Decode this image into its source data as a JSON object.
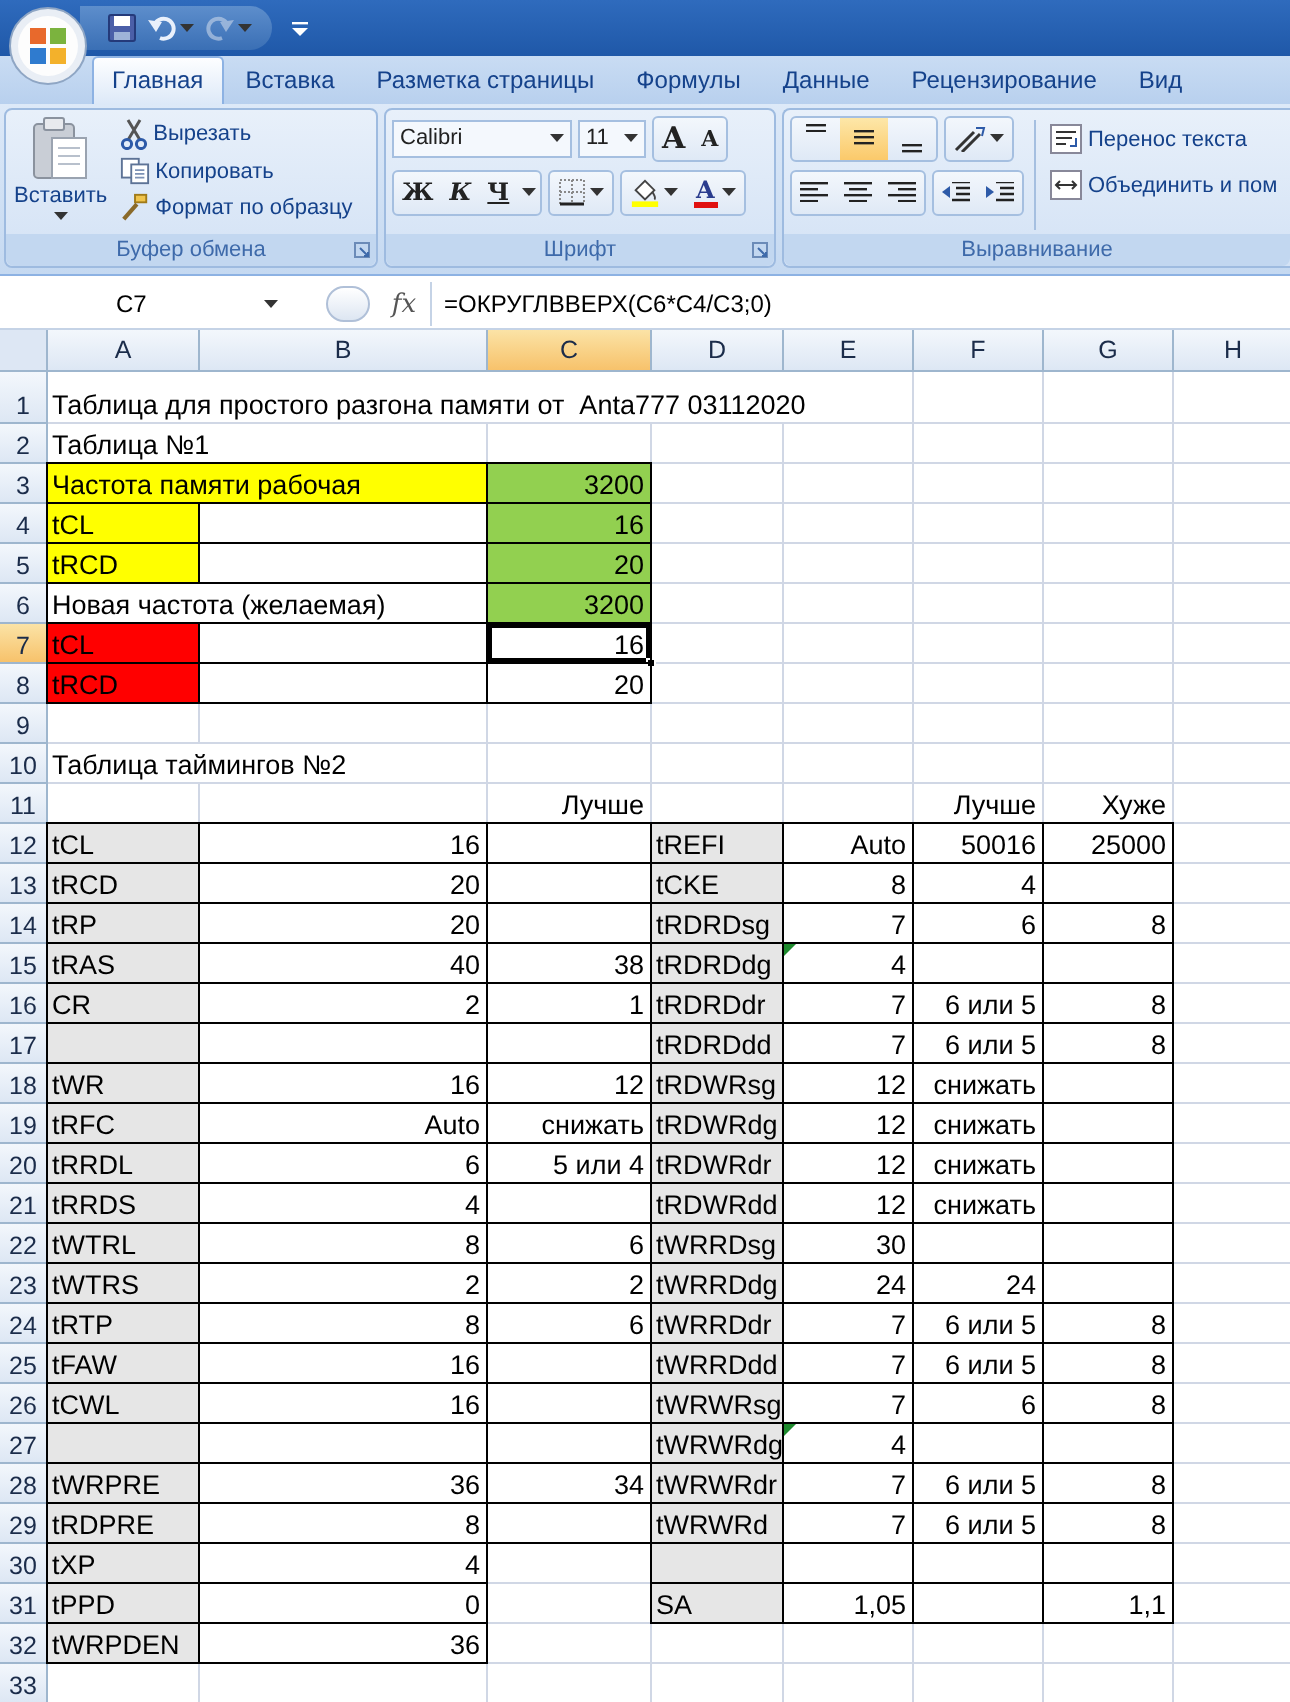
{
  "tabs": [
    {
      "label": "Главная",
      "selected": true
    },
    {
      "label": "Вставка",
      "selected": false
    },
    {
      "label": "Разметка страницы",
      "selected": false
    },
    {
      "label": "Формулы",
      "selected": false
    },
    {
      "label": "Данные",
      "selected": false
    },
    {
      "label": "Рецензирование",
      "selected": false
    },
    {
      "label": "Вид",
      "selected": false
    }
  ],
  "clipboard": {
    "title": "Буфер обмена",
    "paste": "Вставить",
    "cut": "Вырезать",
    "copy": "Копировать",
    "format_painter": "Формат по образцу"
  },
  "font": {
    "title": "Шрифт",
    "family": "Calibri",
    "size": "11",
    "grow": "A",
    "shrink": "A",
    "bold": "Ж",
    "italic": "К",
    "underline": "Ч",
    "font_color": "A"
  },
  "alignment": {
    "title": "Выравнивание",
    "vertical": [
      {
        "kind": "top",
        "selected": false
      },
      {
        "kind": "middle",
        "selected": true
      },
      {
        "kind": "bottom",
        "selected": false
      }
    ],
    "wrap": "Перенос текста",
    "merge": "Объединить и пом"
  },
  "formula_bar": {
    "name_box": "C7",
    "fx": "fx",
    "formula": "=ОКРУГЛВВЕРХ(C6*C4/C3;0)"
  },
  "sheet": {
    "columns": [
      {
        "label": "A",
        "selected": false
      },
      {
        "label": "B",
        "selected": false
      },
      {
        "label": "C",
        "selected": true
      },
      {
        "label": "D",
        "selected": false
      },
      {
        "label": "E",
        "selected": false
      },
      {
        "label": "F",
        "selected": false
      },
      {
        "label": "G",
        "selected": false
      },
      {
        "label": "H",
        "selected": false
      }
    ],
    "rows": [
      {
        "label": "1",
        "selected": false,
        "cells": [
          {
            "kind": "plain",
            "text": "Таблица для простого разгона памяти от  Anta777 03112020"
          },
          {
            "kind": "covered"
          },
          {
            "kind": "covered"
          },
          {
            "kind": "covered"
          },
          {
            "kind": "covered"
          }
        ]
      },
      {
        "label": "2",
        "selected": false,
        "cells": [
          {
            "kind": "plain",
            "text": "Таблица №1"
          },
          {
            "kind": "covered"
          }
        ]
      },
      {
        "label": "3",
        "selected": false,
        "cells": [
          {
            "kind": "boxed",
            "text": "Частота памяти рабочая",
            "color": "#ffff00"
          },
          {
            "kind": "covered"
          },
          {
            "kind": "boxed",
            "text": "3200",
            "color": "#92d050"
          }
        ]
      },
      {
        "label": "4",
        "selected": false,
        "cells": [
          {
            "kind": "boxed",
            "text": "tCL",
            "color": "#ffff00"
          },
          {
            "kind": "boxed"
          },
          {
            "kind": "boxed",
            "text": "16",
            "color": "#92d050"
          }
        ]
      },
      {
        "label": "5",
        "selected": false,
        "cells": [
          {
            "kind": "boxed",
            "text": "tRCD",
            "color": "#ffff00"
          },
          {
            "kind": "boxed"
          },
          {
            "kind": "boxed",
            "text": "20",
            "color": "#92d050"
          }
        ]
      },
      {
        "label": "6",
        "selected": false,
        "cells": [
          {
            "kind": "boxed",
            "text": "Новая частота (желаемая)"
          },
          {
            "kind": "covered"
          },
          {
            "kind": "boxed",
            "text": "3200",
            "color": "#92d050"
          }
        ]
      },
      {
        "label": "7",
        "selected": true,
        "cells": [
          {
            "kind": "boxed",
            "text": "tCL",
            "color": "#ff0000"
          },
          {
            "kind": "boxed"
          },
          {
            "kind": "boxed",
            "text": "16",
            "selected": true
          }
        ]
      },
      {
        "label": "8",
        "selected": false,
        "cells": [
          {
            "kind": "boxed",
            "text": "tRCD",
            "color": "#ff0000"
          },
          {
            "kind": "boxed"
          },
          {
            "kind": "boxed",
            "text": "20"
          }
        ]
      },
      {
        "label": "9",
        "selected": false,
        "cells": []
      },
      {
        "label": "10",
        "selected": false,
        "cells": [
          {
            "kind": "plain",
            "text": "Таблица таймингов №2"
          },
          {
            "kind": "covered"
          }
        ]
      },
      {
        "label": "11",
        "selected": false,
        "cells": [
          {
            "kind": "plain"
          },
          {
            "kind": "plain"
          },
          {
            "kind": "plain",
            "text": "Лучше"
          },
          {
            "kind": "plain"
          },
          {
            "kind": "plain"
          },
          {
            "kind": "plain",
            "text": "Лучше"
          },
          {
            "kind": "plain",
            "text": "Хуже"
          }
        ]
      },
      {
        "label": "12",
        "selected": false,
        "cells": [
          {
            "kind": "boxed",
            "text": "tCL",
            "color": "#e6e6e6"
          },
          {
            "kind": "boxed",
            "text": "16"
          },
          {
            "kind": "boxed"
          },
          {
            "kind": "boxed",
            "text": "tREFI",
            "color": "#e6e6e6"
          },
          {
            "kind": "boxed",
            "text": "Auto"
          },
          {
            "kind": "boxed",
            "text": "50016"
          },
          {
            "kind": "boxed",
            "text": "25000"
          }
        ]
      },
      {
        "label": "13",
        "selected": false,
        "cells": [
          {
            "kind": "boxed",
            "text": "tRCD",
            "color": "#e6e6e6"
          },
          {
            "kind": "boxed",
            "text": "20"
          },
          {
            "kind": "boxed"
          },
          {
            "kind": "boxed",
            "text": "tCKE",
            "color": "#e6e6e6"
          },
          {
            "kind": "boxed",
            "text": "8"
          },
          {
            "kind": "boxed",
            "text": "4"
          },
          {
            "kind": "boxed"
          }
        ]
      },
      {
        "label": "14",
        "selected": false,
        "cells": [
          {
            "kind": "boxed",
            "text": "tRP",
            "color": "#e6e6e6"
          },
          {
            "kind": "boxed",
            "text": "20"
          },
          {
            "kind": "boxed"
          },
          {
            "kind": "boxed",
            "text": "tRDRDsg",
            "color": "#e6e6e6"
          },
          {
            "kind": "boxed",
            "text": "7"
          },
          {
            "kind": "boxed",
            "text": "6"
          },
          {
            "kind": "boxed",
            "text": "8"
          }
        ]
      },
      {
        "label": "15",
        "selected": false,
        "cells": [
          {
            "kind": "boxed",
            "text": "tRAS",
            "color": "#e6e6e6"
          },
          {
            "kind": "boxed",
            "text": "40"
          },
          {
            "kind": "boxed",
            "text": "38"
          },
          {
            "kind": "boxed",
            "text": "tRDRDdg",
            "color": "#e6e6e6"
          },
          {
            "kind": "boxed",
            "text": "4",
            "error_mark": true
          },
          {
            "kind": "boxed"
          },
          {
            "kind": "boxed"
          }
        ]
      },
      {
        "label": "16",
        "selected": false,
        "cells": [
          {
            "kind": "boxed",
            "text": "CR",
            "color": "#e6e6e6"
          },
          {
            "kind": "boxed",
            "text": "2"
          },
          {
            "kind": "boxed",
            "text": "1"
          },
          {
            "kind": "boxed",
            "text": "tRDRDdr",
            "color": "#e6e6e6"
          },
          {
            "kind": "boxed",
            "text": "7"
          },
          {
            "kind": "boxed",
            "text": "6 или 5"
          },
          {
            "kind": "boxed",
            "text": "8"
          }
        ]
      },
      {
        "label": "17",
        "selected": false,
        "cells": [
          {
            "kind": "boxed",
            "color": "#e6e6e6"
          },
          {
            "kind": "boxed"
          },
          {
            "kind": "boxed"
          },
          {
            "kind": "boxed",
            "text": "tRDRDdd",
            "color": "#e6e6e6"
          },
          {
            "kind": "boxed",
            "text": "7"
          },
          {
            "kind": "boxed",
            "text": "6 или 5"
          },
          {
            "kind": "boxed",
            "text": "8"
          }
        ]
      },
      {
        "label": "18",
        "selected": false,
        "cells": [
          {
            "kind": "boxed",
            "text": "tWR",
            "color": "#e6e6e6"
          },
          {
            "kind": "boxed",
            "text": "16"
          },
          {
            "kind": "boxed",
            "text": "12"
          },
          {
            "kind": "boxed",
            "text": "tRDWRsg",
            "color": "#e6e6e6"
          },
          {
            "kind": "boxed",
            "text": "12"
          },
          {
            "kind": "boxed",
            "text": "снижать"
          },
          {
            "kind": "boxed"
          }
        ]
      },
      {
        "label": "19",
        "selected": false,
        "cells": [
          {
            "kind": "boxed",
            "text": "tRFC",
            "color": "#e6e6e6"
          },
          {
            "kind": "boxed",
            "text": "Auto"
          },
          {
            "kind": "boxed",
            "text": "снижать"
          },
          {
            "kind": "boxed",
            "text": "tRDWRdg",
            "color": "#e6e6e6"
          },
          {
            "kind": "boxed",
            "text": "12"
          },
          {
            "kind": "boxed",
            "text": "снижать"
          },
          {
            "kind": "boxed"
          }
        ]
      },
      {
        "label": "20",
        "selected": false,
        "cells": [
          {
            "kind": "boxed",
            "text": "tRRDL",
            "color": "#e6e6e6"
          },
          {
            "kind": "boxed",
            "text": "6"
          },
          {
            "kind": "boxed",
            "text": "5 или 4"
          },
          {
            "kind": "boxed",
            "text": "tRDWRdr",
            "color": "#e6e6e6"
          },
          {
            "kind": "boxed",
            "text": "12"
          },
          {
            "kind": "boxed",
            "text": "снижать"
          },
          {
            "kind": "boxed"
          }
        ]
      },
      {
        "label": "21",
        "selected": false,
        "cells": [
          {
            "kind": "boxed",
            "text": "tRRDS",
            "color": "#e6e6e6"
          },
          {
            "kind": "boxed",
            "text": "4"
          },
          {
            "kind": "boxed"
          },
          {
            "kind": "boxed",
            "text": "tRDWRdd",
            "color": "#e6e6e6"
          },
          {
            "kind": "boxed",
            "text": "12"
          },
          {
            "kind": "boxed",
            "text": "снижать"
          },
          {
            "kind": "boxed"
          }
        ]
      },
      {
        "label": "22",
        "selected": false,
        "cells": [
          {
            "kind": "boxed",
            "text": "tWTRL",
            "color": "#e6e6e6"
          },
          {
            "kind": "boxed",
            "text": "8"
          },
          {
            "kind": "boxed",
            "text": "6"
          },
          {
            "kind": "boxed",
            "text": "tWRRDsg",
            "color": "#e6e6e6"
          },
          {
            "kind": "boxed",
            "text": "30"
          },
          {
            "kind": "boxed"
          },
          {
            "kind": "boxed"
          }
        ]
      },
      {
        "label": "23",
        "selected": false,
        "cells": [
          {
            "kind": "boxed",
            "text": "tWTRS",
            "color": "#e6e6e6"
          },
          {
            "kind": "boxed",
            "text": "2"
          },
          {
            "kind": "boxed",
            "text": "2"
          },
          {
            "kind": "boxed",
            "text": "tWRRDdg",
            "color": "#e6e6e6"
          },
          {
            "kind": "boxed",
            "text": "24"
          },
          {
            "kind": "boxed",
            "text": "24"
          },
          {
            "kind": "boxed"
          }
        ]
      },
      {
        "label": "24",
        "selected": false,
        "cells": [
          {
            "kind": "boxed",
            "text": "tRTP",
            "color": "#e6e6e6"
          },
          {
            "kind": "boxed",
            "text": "8"
          },
          {
            "kind": "boxed",
            "text": "6"
          },
          {
            "kind": "boxed",
            "text": "tWRRDdr",
            "color": "#e6e6e6"
          },
          {
            "kind": "boxed",
            "text": "7"
          },
          {
            "kind": "boxed",
            "text": "6 или 5"
          },
          {
            "kind": "boxed",
            "text": "8"
          }
        ]
      },
      {
        "label": "25",
        "selected": false,
        "cells": [
          {
            "kind": "boxed",
            "text": "tFAW",
            "color": "#e6e6e6"
          },
          {
            "kind": "boxed",
            "text": "16"
          },
          {
            "kind": "boxed"
          },
          {
            "kind": "boxed",
            "text": "tWRRDdd",
            "color": "#e6e6e6"
          },
          {
            "kind": "boxed",
            "text": "7"
          },
          {
            "kind": "boxed",
            "text": "6 или 5"
          },
          {
            "kind": "boxed",
            "text": "8"
          }
        ]
      },
      {
        "label": "26",
        "selected": false,
        "cells": [
          {
            "kind": "boxed",
            "text": "tCWL",
            "color": "#e6e6e6"
          },
          {
            "kind": "boxed",
            "text": "16"
          },
          {
            "kind": "boxed"
          },
          {
            "kind": "boxed",
            "text": "tWRWRsg",
            "color": "#e6e6e6"
          },
          {
            "kind": "boxed",
            "text": "7"
          },
          {
            "kind": "boxed",
            "text": "6"
          },
          {
            "kind": "boxed",
            "text": "8"
          }
        ]
      },
      {
        "label": "27",
        "selected": false,
        "cells": [
          {
            "kind": "boxed",
            "color": "#e6e6e6"
          },
          {
            "kind": "boxed"
          },
          {
            "kind": "boxed"
          },
          {
            "kind": "boxed",
            "text": "tWRWRdg",
            "color": "#e6e6e6"
          },
          {
            "kind": "boxed",
            "text": "4",
            "error_mark": true
          },
          {
            "kind": "boxed"
          },
          {
            "kind": "boxed"
          }
        ]
      },
      {
        "label": "28",
        "selected": false,
        "cells": [
          {
            "kind": "boxed",
            "text": "tWRPRE",
            "color": "#e6e6e6"
          },
          {
            "kind": "boxed",
            "text": "36"
          },
          {
            "kind": "boxed",
            "text": "34"
          },
          {
            "kind": "boxed",
            "text": "tWRWRdr",
            "color": "#e6e6e6"
          },
          {
            "kind": "boxed",
            "text": "7"
          },
          {
            "kind": "boxed",
            "text": "6 или 5"
          },
          {
            "kind": "boxed",
            "text": "8"
          }
        ]
      },
      {
        "label": "29",
        "selected": false,
        "cells": [
          {
            "kind": "boxed",
            "text": "tRDPRE",
            "color": "#e6e6e6"
          },
          {
            "kind": "boxed",
            "text": "8"
          },
          {
            "kind": "boxed"
          },
          {
            "kind": "boxed",
            "text": "tWRWRd",
            "color": "#e6e6e6"
          },
          {
            "kind": "boxed",
            "text": "7"
          },
          {
            "kind": "boxed",
            "text": "6 или 5"
          },
          {
            "kind": "boxed",
            "text": "8"
          }
        ]
      },
      {
        "label": "30",
        "selected": false,
        "cells": [
          {
            "kind": "boxed",
            "text": "tXP",
            "color": "#e6e6e6"
          },
          {
            "kind": "boxed",
            "text": "4"
          },
          {
            "kind": "plain"
          },
          {
            "kind": "boxed",
            "color": "#e6e6e6"
          },
          {
            "kind": "boxed"
          },
          {
            "kind": "boxed"
          },
          {
            "kind": "boxed"
          }
        ]
      },
      {
        "label": "31",
        "selected": false,
        "cells": [
          {
            "kind": "boxed",
            "text": "tPPD",
            "color": "#e6e6e6"
          },
          {
            "kind": "boxed",
            "text": "0"
          },
          {
            "kind": "plain"
          },
          {
            "kind": "boxed",
            "text": "SA",
            "color": "#e6e6e6"
          },
          {
            "kind": "boxed",
            "text": "1,05"
          },
          {
            "kind": "boxed"
          },
          {
            "kind": "boxed",
            "text": "1,1"
          }
        ]
      },
      {
        "label": "32",
        "selected": false,
        "cells": [
          {
            "kind": "boxed",
            "text": "tWRPDEN",
            "color": "#e6e6e6"
          },
          {
            "kind": "boxed",
            "text": "36"
          }
        ]
      },
      {
        "label": "33",
        "selected": false,
        "cells": []
      }
    ]
  }
}
